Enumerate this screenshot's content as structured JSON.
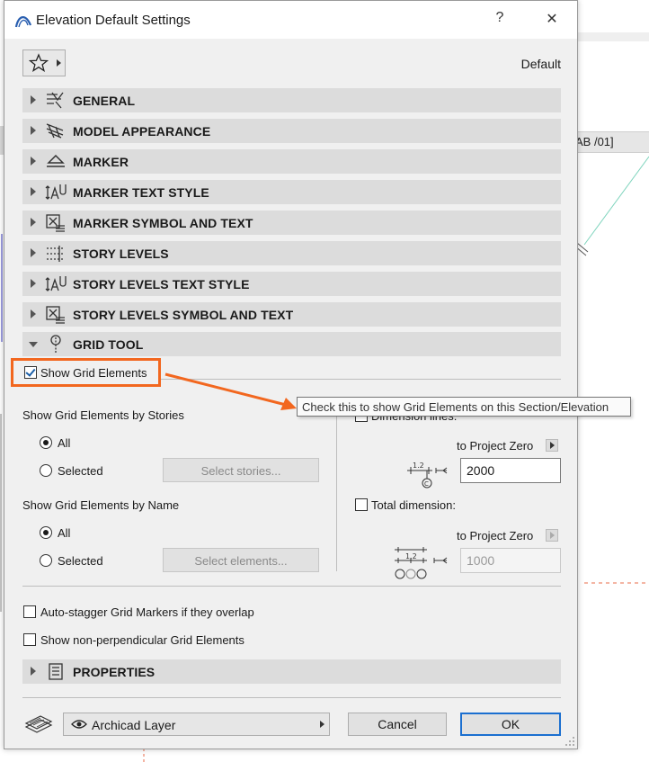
{
  "background": {
    "tab_label": "AB /01]"
  },
  "dialog": {
    "title": "Elevation Default Settings",
    "help_glyph": "?",
    "close_glyph": "✕",
    "favorites_icon": "star-icon",
    "default_label": "Default"
  },
  "sections": {
    "general": "GENERAL",
    "model_appearance": "MODEL APPEARANCE",
    "marker": "MARKER",
    "marker_text_style": "MARKER TEXT STYLE",
    "marker_symbol_and_text": "MARKER SYMBOL AND TEXT",
    "story_levels": "STORY LEVELS",
    "story_levels_text_style": "STORY LEVELS TEXT STYLE",
    "story_levels_symbol_and_text": "STORY LEVELS SYMBOL AND TEXT",
    "grid_tool": "GRID TOOL",
    "properties": "PROPERTIES"
  },
  "grid_tool": {
    "show_grid_elements": "Show Grid Elements",
    "by_stories": {
      "heading": "Show Grid Elements by Stories",
      "all": "All",
      "selected": "Selected",
      "select_button": "Select stories..."
    },
    "by_name": {
      "heading": "Show Grid Elements by Name",
      "all": "All",
      "selected": "Selected",
      "select_button": "Select elements..."
    },
    "dimension_lines": {
      "label": "Dimension lines:",
      "to_project_zero": "to Project Zero",
      "value": "2000"
    },
    "total_dimension": {
      "label": "Total dimension:",
      "to_project_zero": "to Project Zero",
      "value": "1000"
    },
    "auto_stagger": "Auto-stagger Grid Markers if they overlap",
    "non_perpendicular": "Show non-perpendicular Grid Elements"
  },
  "tooltip": "Check this to show Grid Elements on this Section/Elevation",
  "footer": {
    "layer": "Archicad Layer",
    "cancel": "Cancel",
    "ok": "OK"
  },
  "colors": {
    "highlight": "#f2671f",
    "primary_border": "#1b6fd0",
    "checkmark": "#1b5fa8"
  }
}
